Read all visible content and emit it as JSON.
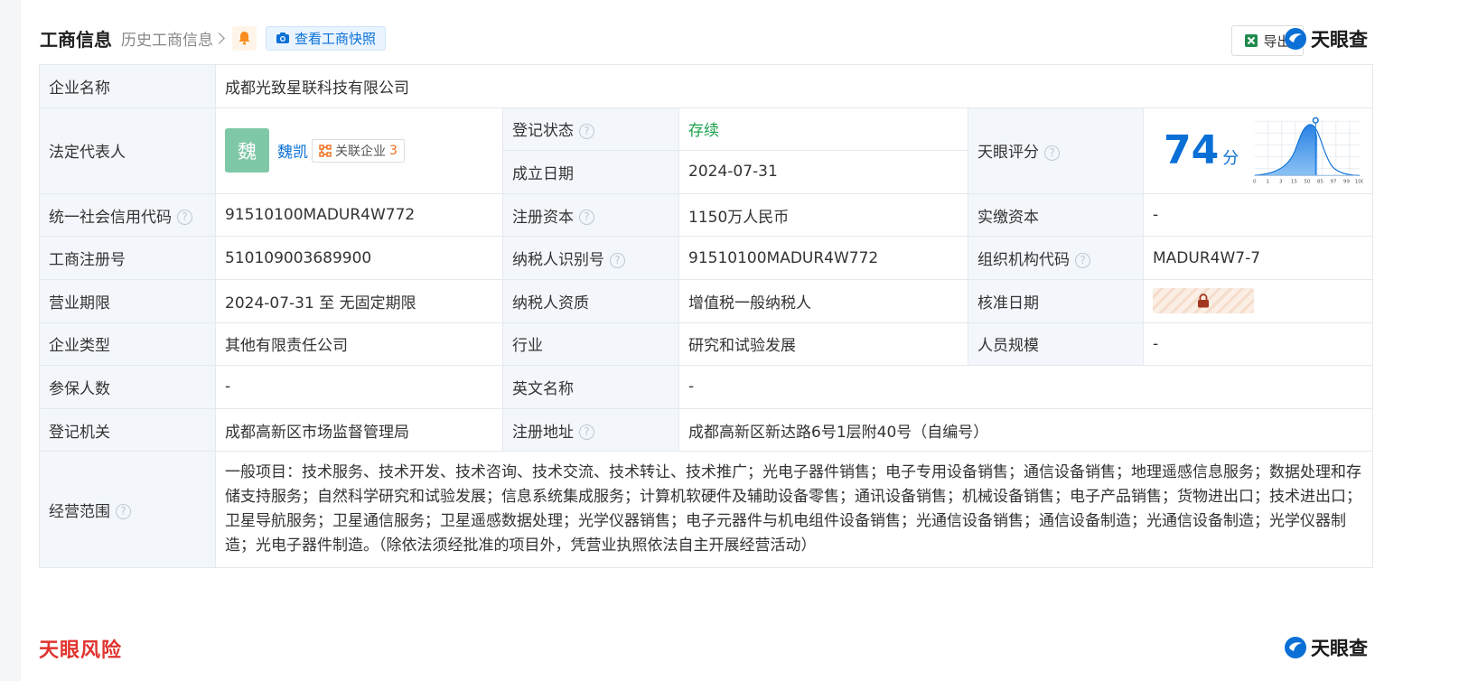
{
  "header": {
    "title": "工商信息",
    "history": "历史工商信息",
    "snapshot": "查看工商快照",
    "export": "导出",
    "brand": "天眼查"
  },
  "rows": {
    "company_name_label": "企业名称",
    "company_name": "成都光致星联科技有限公司",
    "legal_rep_label": "法定代表人",
    "legal_rep_avatar": "魏",
    "legal_rep_name": "魏凯",
    "related_label": "关联企业",
    "related_count": "3",
    "reg_status_label": "登记状态",
    "reg_status": "存续",
    "found_date_label": "成立日期",
    "found_date": "2024-07-31",
    "score_label": "天眼评分",
    "score": "74",
    "score_unit": "分",
    "credit_code_label": "统一社会信用代码",
    "credit_code": "91510100MADUR4W772",
    "reg_capital_label": "注册资本",
    "reg_capital": "1150万人民币",
    "paid_capital_label": "实缴资本",
    "paid_capital": "-",
    "biz_reg_no_label": "工商注册号",
    "biz_reg_no": "510109003689900",
    "taxpayer_id_label": "纳税人识别号",
    "taxpayer_id": "91510100MADUR4W772",
    "org_code_label": "组织机构代码",
    "org_code": "MADUR4W7-7",
    "term_label": "营业期限",
    "term": "2024-07-31 至 无固定期限",
    "taxpayer_qual_label": "纳税人资质",
    "taxpayer_qual": "增值税一般纳税人",
    "approve_date_label": "核准日期",
    "type_label": "企业类型",
    "type": "其他有限责任公司",
    "industry_label": "行业",
    "industry": "研究和试验发展",
    "staff_label": "人员规模",
    "staff": "-",
    "insured_label": "参保人数",
    "insured": "-",
    "en_name_label": "英文名称",
    "en_name": "-",
    "authority_label": "登记机关",
    "authority": "成都高新区市场监督管理局",
    "address_label": "注册地址",
    "address": "成都高新区新达路6号1层附40号（自编号）",
    "scope_label": "经营范围",
    "scope": "一般项目：技术服务、技术开发、技术咨询、技术交流、技术转让、技术推广；光电子器件销售；电子专用设备销售；通信设备销售；地理遥感信息服务；数据处理和存储支持服务；自然科学研究和试验发展；信息系统集成服务；计算机软硬件及辅助设备零售；通讯设备销售；机械设备销售；电子产品销售；货物进出口；技术进出口；卫星导航服务；卫星通信服务；卫星遥感数据处理；光学仪器销售；电子元器件与机电组件设备销售；光通信设备销售；通信设备制造；光通信设备制造；光学仪器制造；光电子器件制造。（除依法须经批准的项目外，凭营业执照依法自主开展经营活动）"
  },
  "score_chart": {
    "ticks": [
      "0",
      "1",
      "3",
      "15",
      "50",
      "85",
      "97",
      "99",
      "100"
    ]
  },
  "footer": {
    "risk_brand": "天眼风险",
    "brand": "天眼查"
  },
  "colors": {
    "accent": "#0a70d6",
    "status": "#1aa14b",
    "risk": "#e0332e"
  }
}
